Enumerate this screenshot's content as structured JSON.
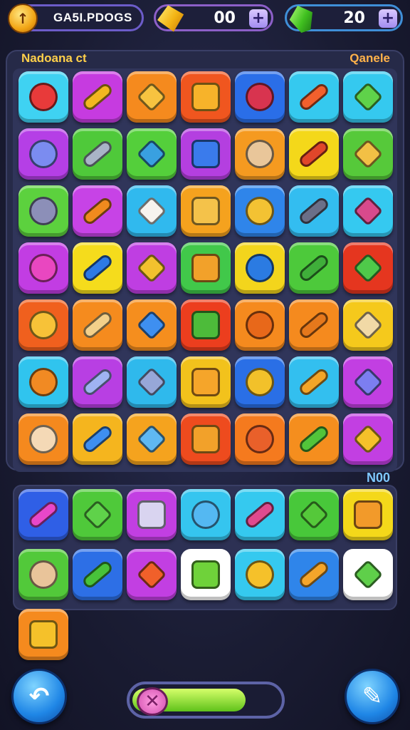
{
  "header": {
    "player_name": "GA5I.PDOGS",
    "gold": "00",
    "gems": "20",
    "plus": "+"
  },
  "board": {
    "title_left": "Nadoana ct",
    "title_right": "Qanele",
    "rows": [
      [
        {
          "c": "#3fd2f2",
          "i": "#e83a3a"
        },
        {
          "c": "#c63be0",
          "i": "#f2b720"
        },
        {
          "c": "#f58a1e",
          "i": "#f7c340"
        },
        {
          "c": "#f0561f",
          "i": "#f7b32a"
        },
        {
          "c": "#2a6ee8",
          "i": "#d8344f"
        },
        {
          "c": "#35c9ef",
          "i": "#f2602d"
        },
        {
          "c": "#35c9ef",
          "i": "#5fd24a"
        }
      ],
      [
        {
          "c": "#b53fe6",
          "i": "#7b8cf0"
        },
        {
          "c": "#4fc93a",
          "i": "#a9b4c7"
        },
        {
          "c": "#54cf3b",
          "i": "#39a0e0"
        },
        {
          "c": "#b43fe0",
          "i": "#3a7bec"
        },
        {
          "c": "#f59a20",
          "i": "#e9c69a"
        },
        {
          "c": "#f4d81a",
          "i": "#e0462a"
        },
        {
          "c": "#56c93a",
          "i": "#f2c045"
        }
      ],
      [
        {
          "c": "#5cd13e",
          "i": "#8c8fb8"
        },
        {
          "c": "#c743e6",
          "i": "#f08a1e"
        },
        {
          "c": "#30b9ee",
          "i": "#f6f3ee"
        },
        {
          "c": "#f5a21e",
          "i": "#f4c24a"
        },
        {
          "c": "#2f85ea",
          "i": "#f3c233"
        },
        {
          "c": "#33bdf0",
          "i": "#6b6f88"
        },
        {
          "c": "#35c9f0",
          "i": "#d84a8c"
        }
      ],
      [
        {
          "c": "#c23de3",
          "i": "#e947c0"
        },
        {
          "c": "#f5dc1c",
          "i": "#2d7ae6"
        },
        {
          "c": "#bf3ee2",
          "i": "#f2c12e"
        },
        {
          "c": "#41c84a",
          "i": "#f2a12a"
        },
        {
          "c": "#f3d51c",
          "i": "#2b7be2"
        },
        {
          "c": "#4dc93b",
          "i": "#3fae3a"
        },
        {
          "c": "#e5361f",
          "i": "#4fc94a"
        }
      ],
      [
        {
          "c": "#f0601e",
          "i": "#f7c238"
        },
        {
          "c": "#f58b1e",
          "i": "#f3d08a"
        },
        {
          "c": "#f58e1e",
          "i": "#3e8ff0"
        },
        {
          "c": "#ec3e1e",
          "i": "#4dbb3a"
        },
        {
          "c": "#f58a1e",
          "i": "#e8681a"
        },
        {
          "c": "#f58a1e",
          "i": "#e5781c"
        },
        {
          "c": "#f5c91c",
          "i": "#f1d9a6"
        }
      ],
      [
        {
          "c": "#30c4ee",
          "i": "#f18a23"
        },
        {
          "c": "#b83fe3",
          "i": "#9fb3f2"
        },
        {
          "c": "#2fb9ec",
          "i": "#97a7d8"
        },
        {
          "c": "#f2c21c",
          "i": "#f5a52a"
        },
        {
          "c": "#2a6fe6",
          "i": "#f2c12a"
        },
        {
          "c": "#33bfef",
          "i": "#f3a528"
        },
        {
          "c": "#c23fe2",
          "i": "#7c7ef0"
        }
      ],
      [
        {
          "c": "#f5891e",
          "i": "#f4d9b6"
        },
        {
          "c": "#f5b51e",
          "i": "#3e8ff0"
        },
        {
          "c": "#f5a31e",
          "i": "#5fb8f2"
        },
        {
          "c": "#ee4b1e",
          "i": "#f2a12a"
        },
        {
          "c": "#f57a1e",
          "i": "#e9602a"
        },
        {
          "c": "#f58e1e",
          "i": "#52c43a"
        },
        {
          "c": "#c23fe2",
          "i": "#f5c12a"
        }
      ]
    ]
  },
  "tray": {
    "label": "N00",
    "rows": [
      [
        {
          "c": "#2f5fe6",
          "i": "#e847c9"
        },
        {
          "c": "#4fc93a",
          "i": "#5fd24a"
        },
        {
          "c": "#c23fe2",
          "i": "#d9d4f0"
        },
        {
          "c": "#35c5ef",
          "i": "#54b8f2"
        },
        {
          "c": "#35c9ef",
          "i": "#e04a8e"
        },
        {
          "c": "#48c83a",
          "i": "#55c83a"
        },
        {
          "c": "#f4d81a",
          "i": "#f29a2a"
        }
      ],
      [
        {
          "c": "#52c93a",
          "i": "#e9c49a"
        },
        {
          "c": "#2d6fe6",
          "i": "#48c23a"
        },
        {
          "c": "#c23fe2",
          "i": "#f0602a"
        },
        {
          "c": "#ffffff",
          "i": "#6fd23a"
        },
        {
          "c": "#35c9ef",
          "i": "#f5c12a"
        },
        {
          "c": "#2f85ea",
          "i": "#f5a52a"
        },
        {
          "c": "#ffffff",
          "i": "#5fcf4a"
        }
      ],
      [
        {
          "c": "#f58a1e",
          "i": "#f5c12a"
        }
      ]
    ]
  },
  "footer": {
    "undo_glyph": "↶",
    "pencil_glyph": "✎",
    "knob_glyph": "✕",
    "progress_fraction": 0.77
  }
}
